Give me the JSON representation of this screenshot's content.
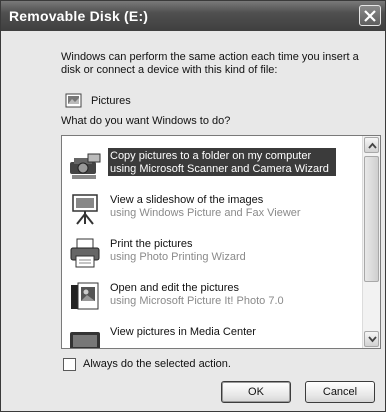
{
  "window": {
    "title": "Removable Disk (E:)"
  },
  "intro_text": "Windows can perform the same action each time you insert a disk or connect a device with this kind of file:",
  "content_type": {
    "icon": "pictures-file-icon",
    "label": "Pictures"
  },
  "question": "What do you want Windows to do?",
  "actions": [
    {
      "title": "Copy pictures to a folder on my computer",
      "subtitle": "using Microsoft Scanner and Camera Wizard",
      "icon": "camera-icon",
      "selected": true
    },
    {
      "title": "View a slideshow of the images",
      "subtitle": "using Windows Picture and Fax Viewer",
      "icon": "slideshow-icon",
      "selected": false
    },
    {
      "title": "Print the pictures",
      "subtitle": "using Photo Printing Wizard",
      "icon": "printer-icon",
      "selected": false
    },
    {
      "title": "Open and edit the pictures",
      "subtitle": "using Microsoft Picture It! Photo 7.0",
      "icon": "photo-editor-icon",
      "selected": false
    },
    {
      "title": "View pictures in Media Center",
      "subtitle": "",
      "icon": "media-center-icon",
      "selected": false
    }
  ],
  "always_checkbox": {
    "label": "Always do the selected action.",
    "checked": false
  },
  "buttons": {
    "ok": "OK",
    "cancel": "Cancel"
  }
}
